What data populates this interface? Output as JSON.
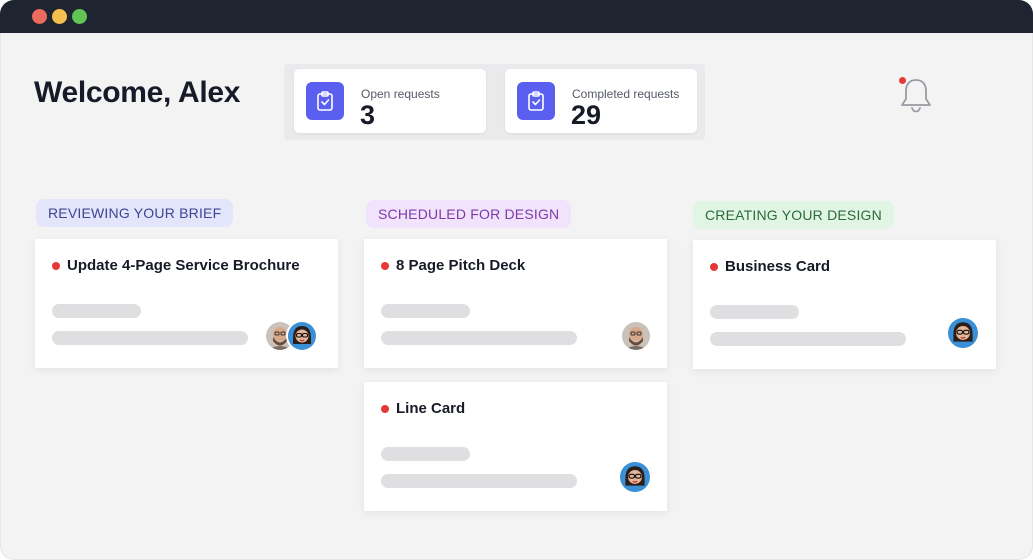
{
  "window": {
    "controls": [
      {
        "name": "close",
        "color": "#ec6a5e"
      },
      {
        "name": "minimize",
        "color": "#f4bf4f"
      },
      {
        "name": "zoom",
        "color": "#61c554"
      }
    ]
  },
  "header": {
    "welcome": "Welcome, Alex"
  },
  "stats": [
    {
      "label": "Open requests",
      "value": "3",
      "icon": "clipboard-check-icon"
    },
    {
      "label": "Completed requests",
      "value": "29",
      "icon": "clipboard-check-icon"
    }
  ],
  "notifications": {
    "icon": "bell-icon",
    "has_unread": true,
    "indicator_color": "#e53935"
  },
  "columns": [
    {
      "status": "REVIEWING YOUR BRIEF",
      "color": "#3d4592",
      "cards": [
        {
          "title": "Update 4-Page Service Brochure",
          "avatars": [
            "bearded-man-avatar",
            "woman-glasses-avatar"
          ]
        }
      ]
    },
    {
      "status": "SCHEDULED FOR DESIGN",
      "color": "#7d3aa8",
      "cards": [
        {
          "title": "8 Page Pitch Deck",
          "avatars": [
            "bearded-man-avatar"
          ]
        },
        {
          "title": "Line Card",
          "avatars": [
            "woman-glasses-avatar"
          ]
        }
      ]
    },
    {
      "status": "CREATING YOUR DESIGN",
      "color": "#2d6a3a",
      "cards": [
        {
          "title": "Business Card",
          "avatars": [
            "woman-glasses-avatar"
          ]
        }
      ]
    }
  ],
  "colors": {
    "accent": "#5b5ff0",
    "priority_dot": "#e53935",
    "titlebar": "#1e2430"
  }
}
